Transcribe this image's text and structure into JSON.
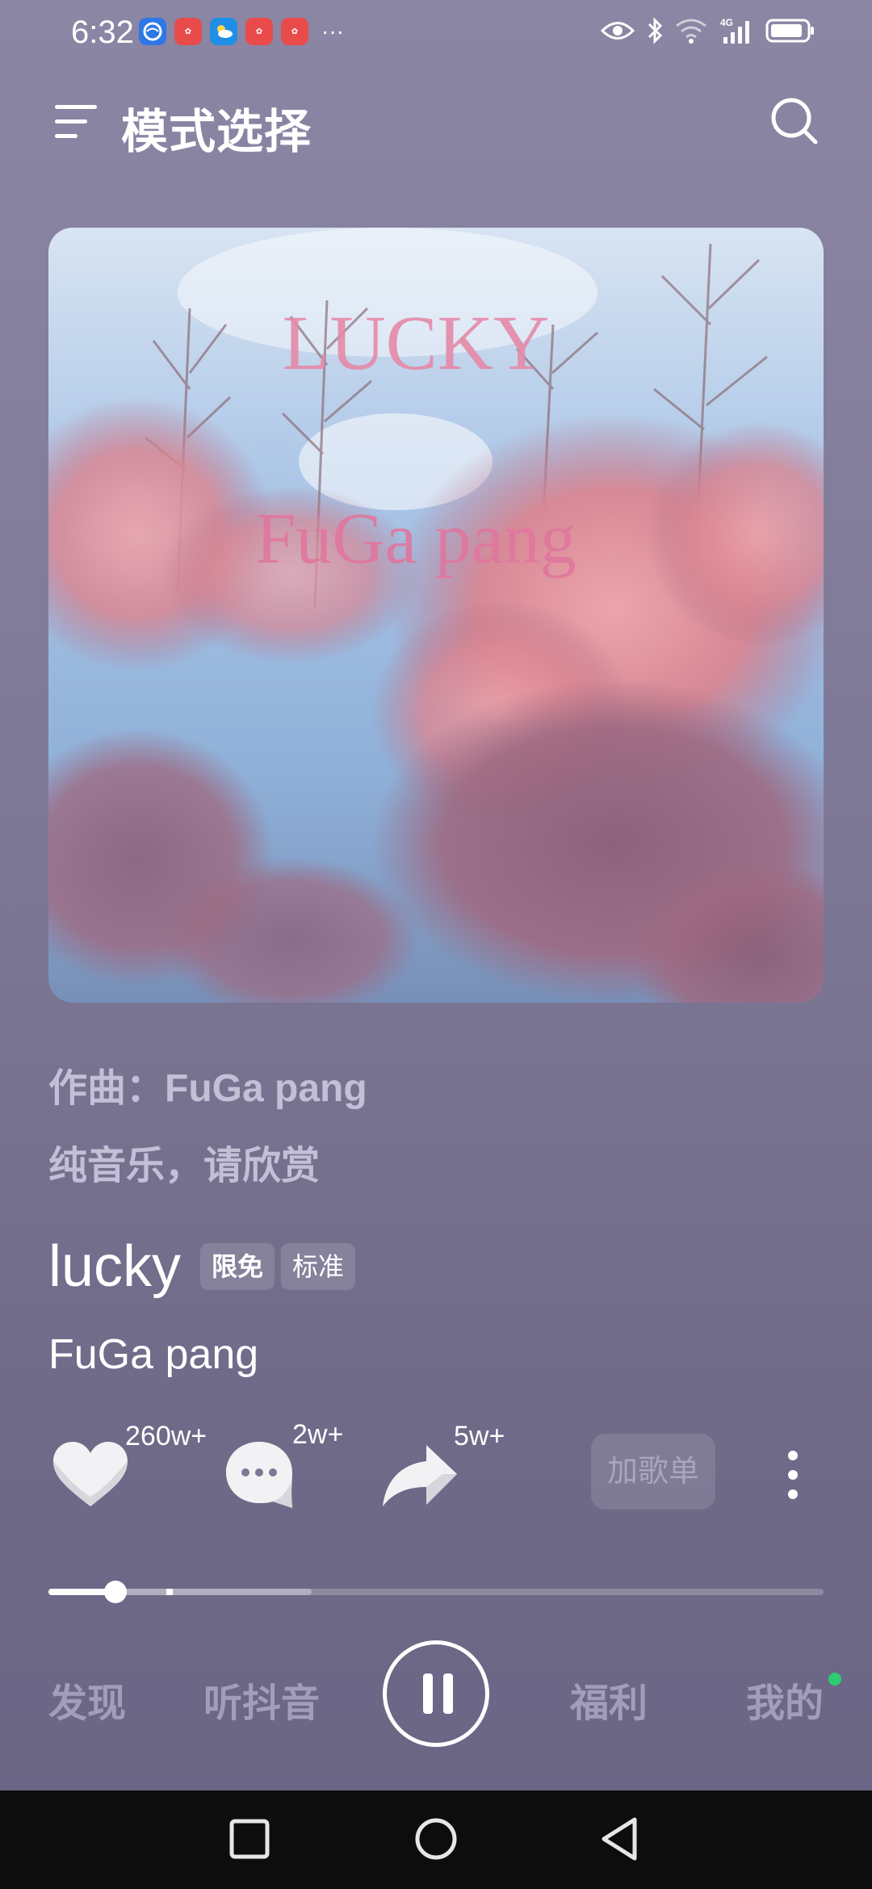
{
  "status_bar": {
    "time": "6:32",
    "network": "4G",
    "notif_icons": [
      "browser-icon",
      "huawei-app-icon",
      "weather-icon",
      "huawei-app-icon",
      "huawei-app-icon"
    ],
    "more": "···"
  },
  "header": {
    "title": "模式选择"
  },
  "cover": {
    "line1": "LUCKY",
    "line2": "FuGa pang"
  },
  "credits": {
    "composer": "作曲：FuGa pang",
    "note": "纯音乐，请欣赏"
  },
  "song": {
    "title": "lucky",
    "badge_free": "限免",
    "badge_quality": "标准",
    "artist": "FuGa pang"
  },
  "actions": {
    "likes": "260w+",
    "comments": "2w+",
    "shares": "5w+",
    "add_playlist": "加歌单"
  },
  "progress": {
    "played_fraction": 0.086,
    "buffered_fraction": 0.34
  },
  "tabs": {
    "discover": "发现",
    "listen_douyin": "听抖音",
    "welfare": "福利",
    "mine": "我的"
  },
  "colors": {
    "accent_green": "#2ecc71",
    "tab_inactive": "#a29eba"
  }
}
